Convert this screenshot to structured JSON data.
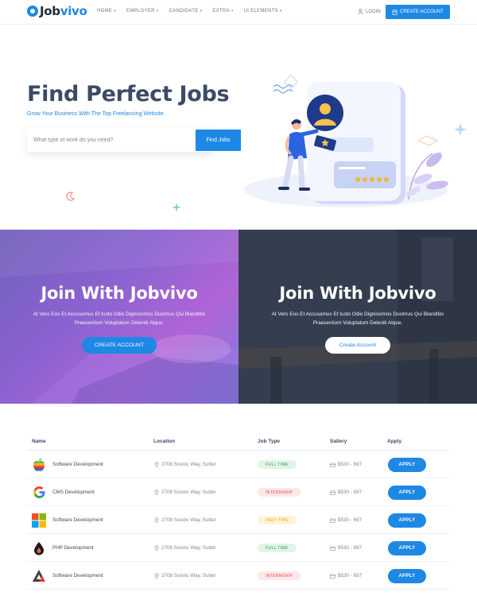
{
  "nav": {
    "logo_part1": "Job",
    "logo_part2": "vivo",
    "menu": [
      "HOME",
      "EMPLOYER",
      "CANDIDATE",
      "EXTRA",
      "UI ELEMENTS"
    ],
    "login_label": "LOGIN",
    "create_account_label": "CREATE ACCOUNT"
  },
  "hero": {
    "title": "Find Perfect Jobs",
    "subtitle": "Grow Your Business With The Top Freelancing Website.",
    "search_placeholder": "What type of work do you need?",
    "search_button": "Find Jobs"
  },
  "banners": [
    {
      "title": "Join With Jobvivo",
      "text": "At Vero Eos Et Accusamus Et Iusto Odio Dignissimos Ducimus Qui Blanditiis Praesentium Voluptatum Deleniti Atque.",
      "button": "CREATE ACCOUNT"
    },
    {
      "title": "Join With Jobvivo",
      "text": "At Vero Eos Et Accusamus Et Iusto Odio Dignissimos Ducimus Qui Blanditiis Praesentium Voluptatum Deleniti Atque.",
      "button": "Create Account"
    }
  ],
  "table": {
    "headers": [
      "Name",
      "Location",
      "Job Type",
      "Sallery",
      "Apply"
    ],
    "rows": [
      {
        "logo": "apple-logo",
        "name": "Software Development",
        "location": "2708 Scenic Way, Sutter",
        "type": "FULL TIME",
        "type_style": "full",
        "salary": "$530 - 697",
        "apply": "APPLY"
      },
      {
        "logo": "google-logo",
        "name": "CMS Development",
        "location": "2708 Scenic Way, Sutter",
        "type": "INTERNSHIP",
        "type_style": "intern",
        "salary": "$530 - 697",
        "apply": "APPLY"
      },
      {
        "logo": "microsoft-logo",
        "name": "Software Development",
        "location": "2708 Scenic Way, Sutter",
        "type": "PART TIME",
        "type_style": "part",
        "salary": "$530 - 697",
        "apply": "APPLY"
      },
      {
        "logo": "php-drop-logo",
        "name": "PHP Development",
        "location": "2708 Scenic Way, Sutter",
        "type": "FULL TIME",
        "type_style": "full",
        "salary": "$530 - 697",
        "apply": "APPLY"
      },
      {
        "logo": "triangle-logo",
        "name": "Software Development",
        "location": "2708 Scenic Way, Sutter",
        "type": "INTERNSHIP",
        "type_style": "intern",
        "salary": "$530 - 697",
        "apply": "APPLY"
      }
    ]
  },
  "colors": {
    "primary": "#1e88e5",
    "heading": "#3b4b66",
    "full_time": "#35a155",
    "internship": "#e84d5b",
    "part_time": "#f4a724"
  }
}
